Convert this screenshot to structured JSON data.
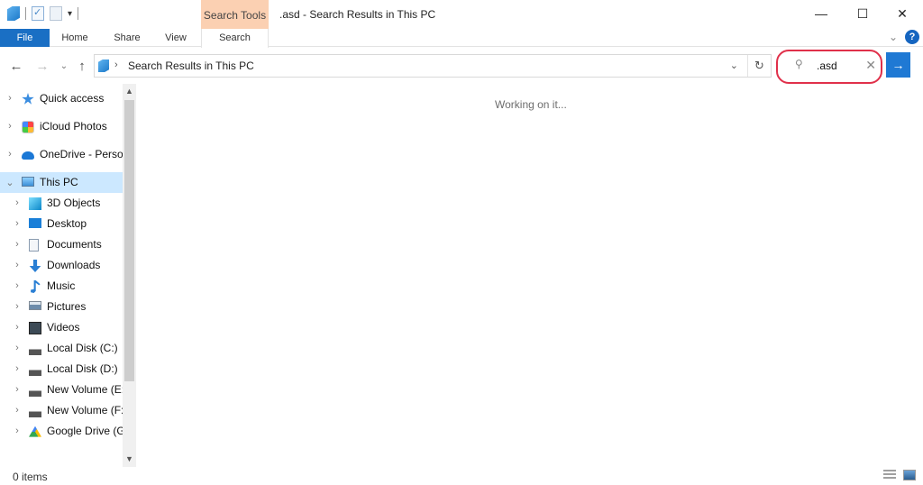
{
  "titlebar": {
    "title": ".asd - Search Results in This PC",
    "context_tab": "Search Tools",
    "qat_dropdown": "▾",
    "minimize": "—",
    "maximize": "☐",
    "close": "✕"
  },
  "ribbon": {
    "tabs": [
      {
        "label": "File"
      },
      {
        "label": "Home"
      },
      {
        "label": "Share"
      },
      {
        "label": "View"
      },
      {
        "label": "Search"
      }
    ],
    "collapse_icon": "⌄",
    "help_icon": "?"
  },
  "navigation": {
    "back": "←",
    "forward": "→",
    "recent": "⌄",
    "up": "↑",
    "breadcrumb_sep": "›",
    "address": "Search Results in This PC",
    "address_dropdown": "⌄",
    "refresh": "↻"
  },
  "search": {
    "icon": "⚲",
    "value": ".asd",
    "clear": "✕",
    "go": "→",
    "highlight_color": "#e0304a"
  },
  "sidebar": {
    "items": [
      {
        "label": "Quick access",
        "icon": "star-icon",
        "chevron": "›"
      },
      {
        "label": "iCloud Photos",
        "icon": "icloud-photos-icon",
        "chevron": "›"
      },
      {
        "label": "OneDrive - Persor",
        "icon": "onedrive-icon",
        "chevron": "›"
      },
      {
        "label": "This PC",
        "icon": "computer-icon",
        "chevron": "⌄",
        "selected": true
      },
      {
        "label": "3D Objects",
        "icon": "3d-objects-icon",
        "chevron": "›"
      },
      {
        "label": "Desktop",
        "icon": "desktop-icon",
        "chevron": "›"
      },
      {
        "label": "Documents",
        "icon": "documents-icon",
        "chevron": "›"
      },
      {
        "label": "Downloads",
        "icon": "downloads-icon",
        "chevron": "›"
      },
      {
        "label": "Music",
        "icon": "music-icon",
        "chevron": "›"
      },
      {
        "label": "Pictures",
        "icon": "pictures-icon",
        "chevron": "›"
      },
      {
        "label": "Videos",
        "icon": "videos-icon",
        "chevron": "›"
      },
      {
        "label": "Local Disk (C:)",
        "icon": "system-drive-icon",
        "chevron": "›"
      },
      {
        "label": "Local Disk (D:)",
        "icon": "drive-icon",
        "chevron": "›"
      },
      {
        "label": "New Volume (E:)",
        "icon": "drive-icon",
        "chevron": "›"
      },
      {
        "label": "New Volume (F:)",
        "icon": "drive-icon",
        "chevron": "›"
      },
      {
        "label": "Google Drive (G:",
        "icon": "google-drive-icon",
        "chevron": "›"
      }
    ],
    "scroll_up": "▲",
    "scroll_down": "▼",
    "selected_color": "#cce8ff"
  },
  "content": {
    "status_message": "Working on it..."
  },
  "statusbar": {
    "item_count": "0 items"
  },
  "colors": {
    "accent": "#1a6fc4",
    "context_tab": "#fbd0b2"
  }
}
